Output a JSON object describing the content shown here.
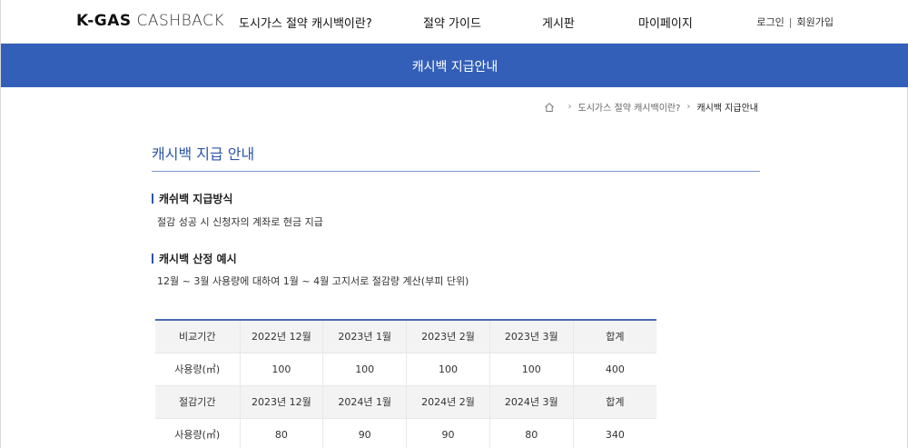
{
  "header": {
    "logo_bold": "K-GAS",
    "logo_light": "CASHBACK",
    "nav": [
      {
        "label": "도시가스 절약 캐시백이란?"
      },
      {
        "label": "절약 가이드"
      },
      {
        "label": "게시판"
      },
      {
        "label": "마이페이지"
      }
    ],
    "login": "로그인",
    "separator": "|",
    "signup": "회원가입"
  },
  "banner": {
    "title": "캐시백 지급안내"
  },
  "breadcrumb": {
    "parent": "도시가스 절약 캐시백이란?",
    "current": "캐시백 지급안내"
  },
  "page_title": "캐시백 지급 안내",
  "sections": [
    {
      "heading": "캐쉬백 지급방식",
      "text": "절감 성공 시 신청자의 계좌로 현금 지급"
    },
    {
      "heading": "캐시백 산정 예시",
      "text": "12월 ~ 3월 사용량에 대하여 1월 ~ 4월 고지서로 절감량 계산(부피 단위)"
    }
  ],
  "table": {
    "rows": [
      {
        "type": "head",
        "cells": [
          "비교기간",
          "2022년 12월",
          "2023년 1월",
          "2023년 2월",
          "2023년 3월",
          "합계"
        ]
      },
      {
        "type": "data",
        "cells": [
          "사용량(㎥)",
          "100",
          "100",
          "100",
          "100",
          "400"
        ]
      },
      {
        "type": "head",
        "cells": [
          "절감기간",
          "2023년 12월",
          "2024년 1월",
          "2024년 2월",
          "2024년 3월",
          "합계"
        ]
      },
      {
        "type": "data",
        "cells": [
          "사용량(㎥)",
          "80",
          "90",
          "90",
          "80",
          "340"
        ]
      }
    ]
  },
  "colors": {
    "accent": "#335fb8",
    "title": "#2c55a8"
  },
  "icons": {
    "home": "home-icon",
    "chevron": "chevron-right-icon"
  }
}
